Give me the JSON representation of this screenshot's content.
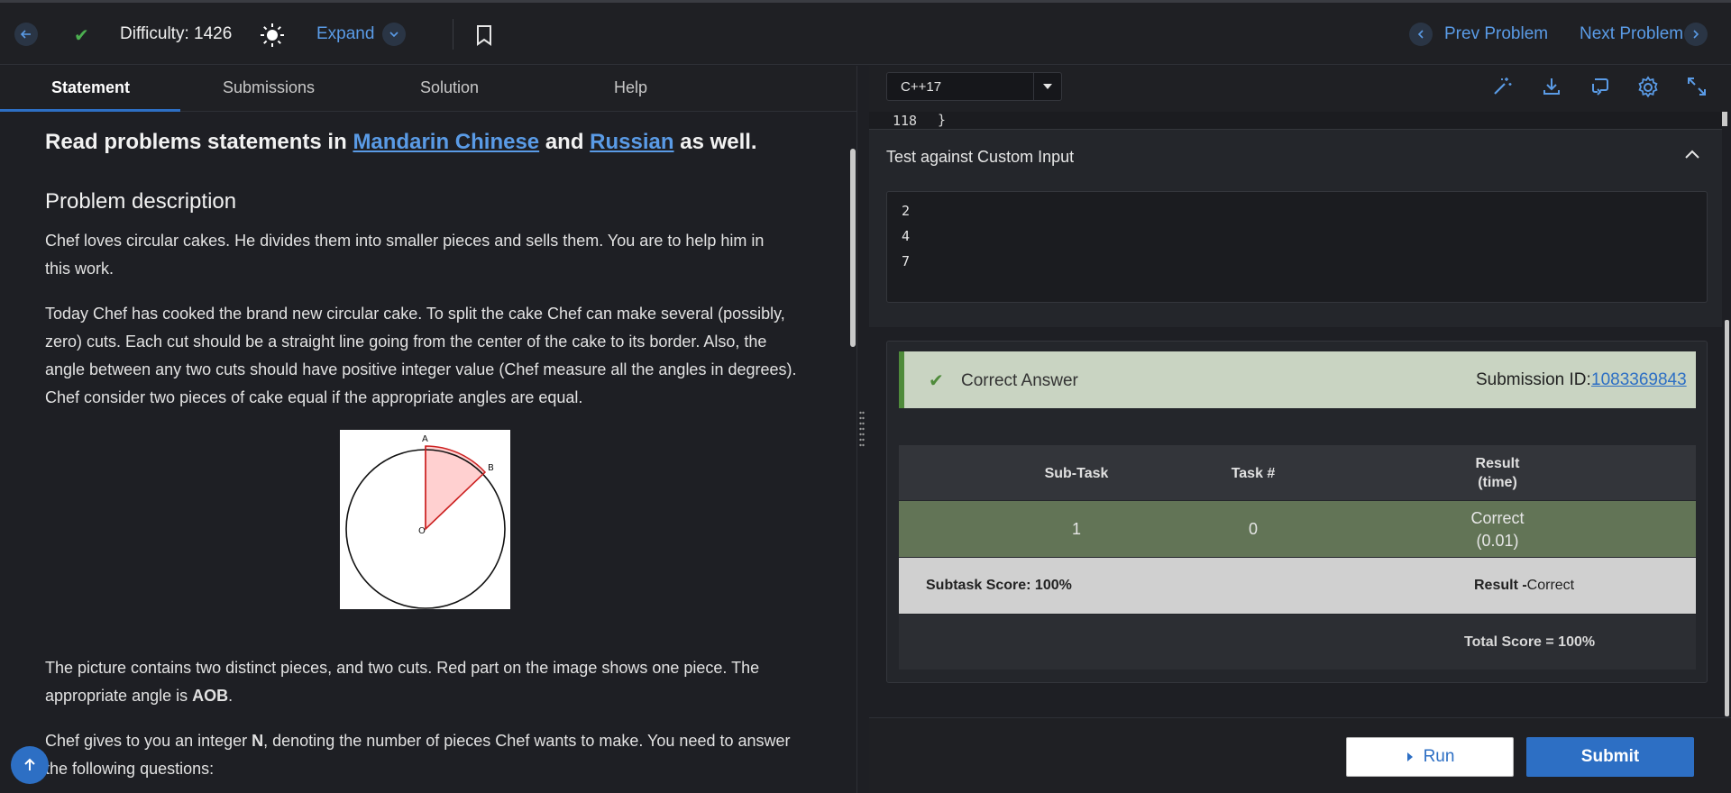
{
  "header": {
    "difficulty": "Difficulty: 1426",
    "expand_label": "Expand",
    "prev_label": "Prev Problem",
    "next_label": "Next Problem"
  },
  "tabs": [
    "Statement",
    "Submissions",
    "Solution",
    "Help"
  ],
  "statement": {
    "heading_pre": "Read problems statements in ",
    "link1": "Mandarin Chinese",
    "heading_mid": " and ",
    "link2": "Russian",
    "heading_post": " as well.",
    "subheading": "Problem description",
    "para1_line1": "Chef loves circular cakes. He divides them into smaller pieces and sells them. You are to help him in",
    "para1_line2": "this work.",
    "para2_line1": "Today Chef has cooked the brand new circular cake. To split the cake Chef can make several (possibly,",
    "para2_line2": "zero) cuts. Each cut should be a straight line going from the center of the cake to its border. Also, the",
    "para2_line3": "angle between any two cuts should have positive integer value (Chef measure all the angles in degrees).",
    "para2_line4": "Chef consider two pieces of cake equal if the appropriate angles are equal.",
    "para3_line1": "The picture contains two distinct pieces, and two cuts. Red part on the image shows one piece. The",
    "para3_line2_pre": "appropriate angle is ",
    "para3_line2_bold": "AOB",
    "para3_line2_post": ".",
    "para4_line1_pre": "Chef gives to you an integer ",
    "para4_line1_bold": "N",
    "para4_line1_post": ", denoting the number of pieces Chef wants to make. You need to answer",
    "para4_line2": "the following questions:",
    "image_labels": {
      "a": "A",
      "b": "B",
      "o": "O"
    }
  },
  "editor": {
    "language": "C++17",
    "line_number": "118",
    "line_code": "}"
  },
  "custom_input": {
    "title": "Test against Custom Input",
    "values": [
      "2",
      "4",
      "7"
    ]
  },
  "result": {
    "status": "Correct Answer",
    "submission_label": "Submission ID:",
    "submission_id": "1083369843",
    "columns": [
      "Sub-Task",
      "Task #",
      "Result",
      "(time)"
    ],
    "row": {
      "subtask": "1",
      "task": "0",
      "result": "Correct",
      "time": "(0.01)"
    },
    "subtask_score": "Subtask Score: 100%",
    "result_label": "Result - ",
    "result_value": "Correct",
    "total_score": "Total Score = 100%"
  },
  "actions": {
    "run_label": "Run",
    "submit_label": "Submit"
  },
  "colors": {
    "accent": "#2d6fc4",
    "link": "#5a9be6",
    "success": "#4f8b3b"
  }
}
